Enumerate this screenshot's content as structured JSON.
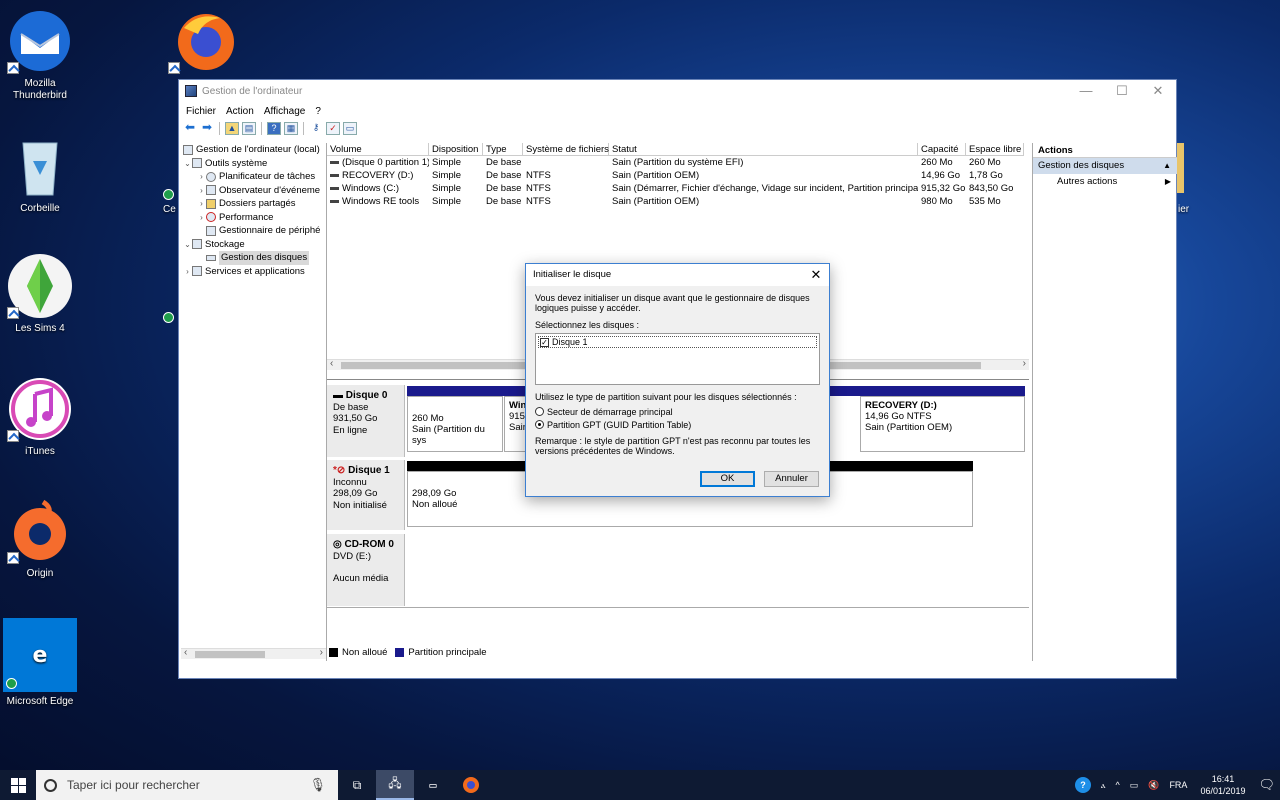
{
  "desktop": {
    "icons": [
      {
        "label": "Mozilla\nThunderbird",
        "color": "#1c6bd6"
      },
      {
        "label": "Corbeille",
        "color": "#9fc3d8"
      },
      {
        "label": "Les Sims 4",
        "color": "#3fa53a"
      },
      {
        "label": "iTunes",
        "color": "#d94ab5"
      },
      {
        "label": "Origin",
        "color": "#f56c2d"
      },
      {
        "label": "Microsoft Edge",
        "color": "#0078d7"
      }
    ],
    "partial_left": "Ce l",
    "partial_right": "ier"
  },
  "window": {
    "title": "Gestion de l'ordinateur",
    "menu": [
      "Fichier",
      "Action",
      "Affichage",
      "?"
    ],
    "controls": {
      "minimize": "—",
      "maximize": "☐",
      "close": "✕"
    }
  },
  "tree": {
    "items": [
      {
        "label": "Gestion de l'ordinateur (local)",
        "indent": 0,
        "arrow": ""
      },
      {
        "label": "Outils système",
        "indent": 1,
        "arrow": "⌄"
      },
      {
        "label": "Planificateur de tâches",
        "indent": 2,
        "arrow": "›"
      },
      {
        "label": "Observateur d'événeme",
        "indent": 2,
        "arrow": "›"
      },
      {
        "label": "Dossiers partagés",
        "indent": 2,
        "arrow": "›"
      },
      {
        "label": "Performance",
        "indent": 2,
        "arrow": "›"
      },
      {
        "label": "Gestionnaire de périphé",
        "indent": 2,
        "arrow": ""
      },
      {
        "label": "Stockage",
        "indent": 1,
        "arrow": "⌄"
      },
      {
        "label": "Gestion des disques",
        "indent": 2,
        "arrow": "",
        "selected": true
      },
      {
        "label": "Services et applications",
        "indent": 1,
        "arrow": "›"
      }
    ]
  },
  "volumes": {
    "headers": [
      "Volume",
      "Disposition",
      "Type",
      "Système de fichiers",
      "Statut",
      "Capacité",
      "Espace libre"
    ],
    "rows": [
      [
        "(Disque 0 partition 1)",
        "Simple",
        "De base",
        "",
        "Sain (Partition du système EFI)",
        "260 Mo",
        "260 Mo"
      ],
      [
        "RECOVERY (D:)",
        "Simple",
        "De base",
        "NTFS",
        "Sain (Partition OEM)",
        "14,96 Go",
        "1,78 Go"
      ],
      [
        "Windows (C:)",
        "Simple",
        "De base",
        "NTFS",
        "Sain (Démarrer, Fichier d'échange, Vidage sur incident, Partition principale)",
        "915,32 Go",
        "843,50 Go"
      ],
      [
        "Windows RE tools",
        "Simple",
        "De base",
        "NTFS",
        "Sain (Partition OEM)",
        "980 Mo",
        "535 Mo"
      ]
    ]
  },
  "disks": {
    "disk0": {
      "name": "Disque 0",
      "type": "De base",
      "size": "931,50 Go",
      "status": "En ligne",
      "p1_size": "260 Mo",
      "p1_status": "Sain (Partition du sys",
      "p2_name": "Win",
      "p2_size": "915,",
      "p2_status": "Sain",
      "p3_name": "RECOVERY  (D:)",
      "p3_size": "14,96 Go NTFS",
      "p3_status": "Sain (Partition OEM)"
    },
    "disk1": {
      "name": "Disque 1",
      "type": "Inconnu",
      "size": "298,09 Go",
      "status": "Non initialisé",
      "p1_size": "298,09 Go",
      "p1_status": "Non alloué"
    },
    "cdrom": {
      "name": "CD-ROM 0",
      "type": "DVD (E:)",
      "status": "Aucun média"
    }
  },
  "legend": {
    "unallocated": "Non alloué",
    "primary": "Partition principale"
  },
  "actions": {
    "header": "Actions",
    "section": "Gestion des disques",
    "item": "Autres actions"
  },
  "dialog": {
    "title": "Initialiser le disque",
    "intro": "Vous devez initialiser un disque avant que le gestionnaire de disques logiques puisse y accéder.",
    "select_label": "Sélectionnez les disques :",
    "disk_item": "Disque 1",
    "partition_label": "Utilisez le type de partition suivant pour les disques sélectionnés :",
    "option_mbr": "Secteur de démarrage principal",
    "option_gpt": "Partition GPT (GUID Partition Table)",
    "note": "Remarque : le style de partition GPT n'est pas reconnu par toutes les versions précédentes de Windows.",
    "ok": "OK",
    "cancel": "Annuler"
  },
  "taskbar": {
    "search_placeholder": "Taper ici pour rechercher",
    "lang": "FRA",
    "time": "16:41",
    "date": "06/01/2019"
  },
  "colors": {
    "primary_partition": "#1a1a8c",
    "unallocated": "#000000",
    "accent": "#0078d7"
  }
}
